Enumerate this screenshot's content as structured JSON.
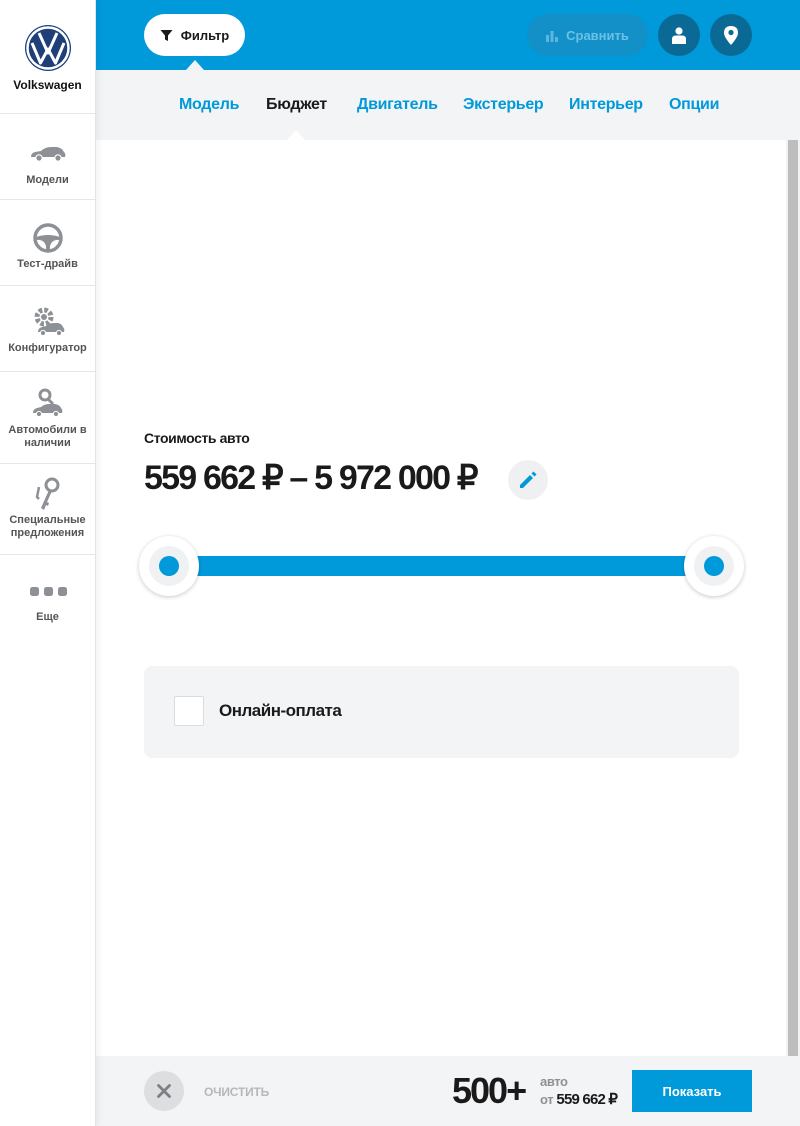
{
  "brand": {
    "name": "Volkswagen"
  },
  "sidebar": {
    "items": [
      {
        "label": "Модели",
        "icon": "car-icon"
      },
      {
        "label": "Тест-драйв",
        "icon": "steering-wheel-icon"
      },
      {
        "label": "Конфигуратор",
        "icon": "configurator-icon"
      },
      {
        "label": "Автомобили в наличии",
        "icon": "car-in-stock-icon"
      },
      {
        "label": "Специальные предложения",
        "icon": "keys-icon"
      },
      {
        "label": "Еще",
        "icon": "more-dots-icon"
      }
    ]
  },
  "topbar": {
    "filter_label": "Фильтр",
    "compare_label": "Сравнить"
  },
  "tabs": [
    {
      "label": "Модель",
      "active": false
    },
    {
      "label": "Бюджет",
      "active": true
    },
    {
      "label": "Двигатель",
      "active": false
    },
    {
      "label": "Экстерьер",
      "active": false
    },
    {
      "label": "Интерьер",
      "active": false
    },
    {
      "label": "Опции",
      "active": false
    }
  ],
  "budget": {
    "label": "Стоимость авто",
    "range_text": "559 662 ₽ – 5 972 000 ₽",
    "min": 559662,
    "max": 5972000,
    "selected_min": 559662,
    "selected_max": 5972000
  },
  "online_payment": {
    "label": "Онлайн-оплата",
    "checked": false
  },
  "bottom": {
    "clear_label": "ОЧИСТИТЬ",
    "count": "500+",
    "count_unit": "авто",
    "from_prefix": "от",
    "from_price": "559 662 ₽",
    "show_label": "Показать"
  },
  "colors": {
    "accent": "#0099da",
    "panel": "#f3f4f5",
    "text": "#1a1a1a"
  }
}
